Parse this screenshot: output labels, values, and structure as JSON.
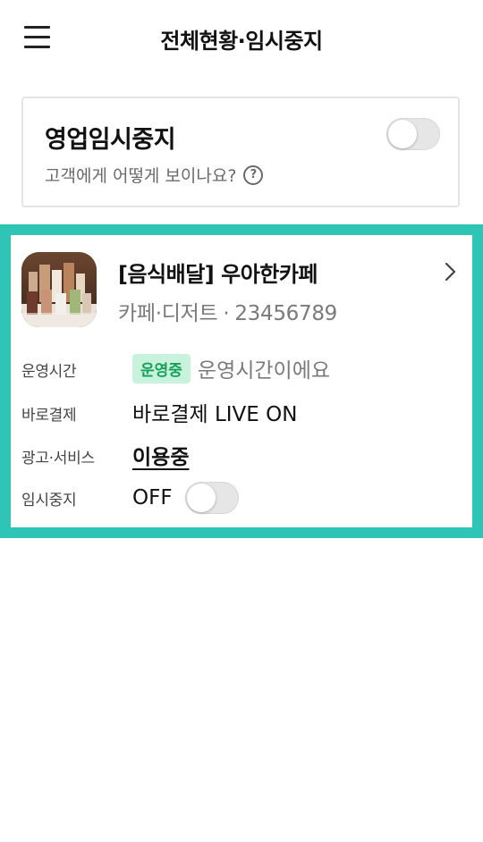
{
  "header": {
    "title": "전체현황·임시중지",
    "menu_icon": "hamburger-menu-icon"
  },
  "pause_card": {
    "title": "영업임시중지",
    "help_text": "고객에게 어떻게 보이나요?",
    "help_icon": "question-circle-icon",
    "help_glyph": "?",
    "toggle_on": false
  },
  "store": {
    "name": "[음식배달] 우아한카페",
    "category": "카페·디저트",
    "separator": "·",
    "store_id": "23456789",
    "thumbnail": "drinks-photo",
    "chevron": "chevron-right-icon",
    "frame_color": "#2ec4b6",
    "rows": [
      {
        "label": "운영시간",
        "badge": "운영중",
        "value": "운영시간이에요"
      },
      {
        "label": "바로결제",
        "value": "바로결제 LIVE ON"
      },
      {
        "label": "광고·서비스",
        "value": "이용중"
      },
      {
        "label": "임시중지",
        "value": "OFF",
        "toggle_on": false
      }
    ]
  },
  "colors": {
    "badge_bg": "#c9f2dd",
    "badge_text": "#16a05a",
    "toggle_off": "#e6e6e6"
  }
}
